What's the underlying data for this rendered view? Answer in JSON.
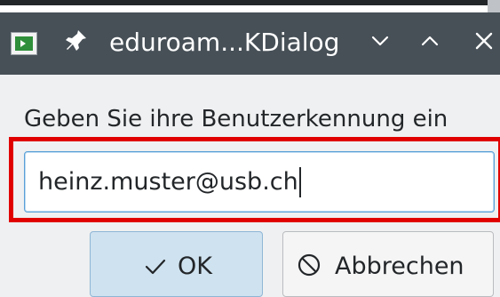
{
  "window": {
    "title": "eduroam...KDialog",
    "app_icon": "terminal-run-icon",
    "pin_icon": "pin-icon",
    "controls": [
      "chevron-down-icon",
      "chevron-up-icon",
      "close-icon"
    ]
  },
  "dialog": {
    "prompt": "Geben Sie ihre Benutzerkennung ein",
    "input": {
      "value": "heinz.muster@usb.ch"
    },
    "buttons": {
      "ok": {
        "label": "OK",
        "icon": "check-icon"
      },
      "cancel": {
        "label": "Abbrechen",
        "icon": "cancel-circle-icon"
      }
    }
  },
  "colors": {
    "titlebar": "#475057",
    "dialog_bg": "#eff0f1",
    "highlight": "#e00000",
    "focus": "#5aa0d8",
    "ok_button": "#cfe2ef"
  }
}
